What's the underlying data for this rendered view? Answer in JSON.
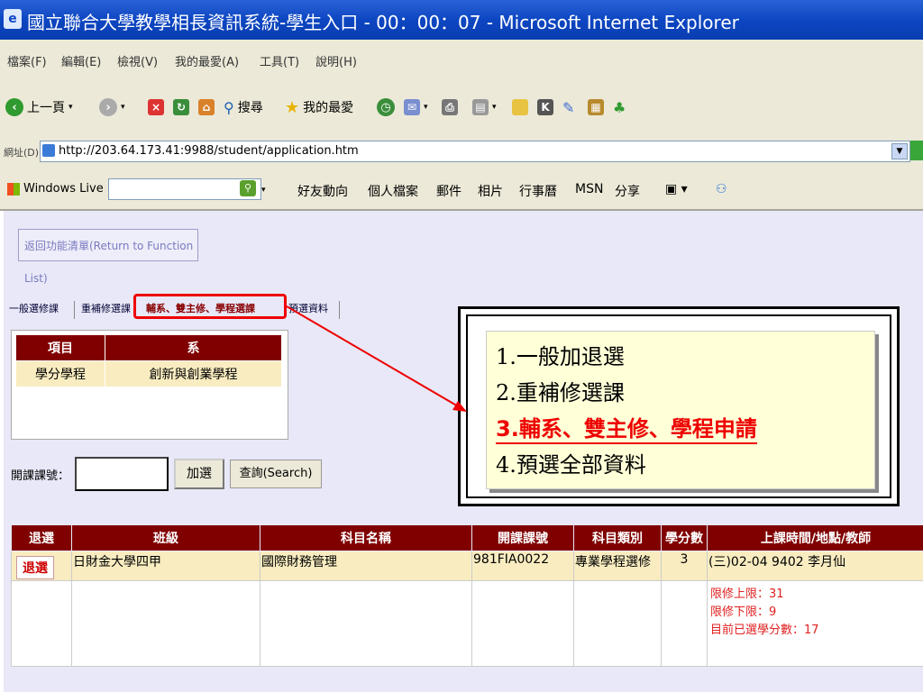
{
  "window": {
    "title": "國立聯合大學教學相長資訊系統-學生入口 - 00：00：07 - Microsoft Internet Explorer"
  },
  "menu": [
    "檔案(F)",
    "編輯(E)",
    "檢視(V)",
    "我的最愛(A)",
    "工具(T)",
    "說明(H)"
  ],
  "toolbar": {
    "back": "上一頁",
    "search": "搜尋",
    "favorites": "我的最愛"
  },
  "address": {
    "label": "網址(D)",
    "url": "http://203.64.173.41:9988/student/application.htm"
  },
  "live": {
    "brand": "Windows Live",
    "links": [
      "好友動向",
      "個人檔案",
      "郵件",
      "相片",
      "行事曆",
      "MSN",
      "分享"
    ]
  },
  "page": {
    "return_button": "返回功能清單(Return to Function List)",
    "tabs": [
      "一般選修課",
      "重補修選課",
      "輔系、雙主修、學程選課",
      "預選資料"
    ],
    "major_table": {
      "headers": [
        "項目",
        "系"
      ],
      "rows": [
        [
          "學分學程",
          "創新與創業學程"
        ]
      ]
    },
    "course_label": "開課課號：",
    "add_button": "加選",
    "search_button": "查詢(Search)",
    "enroll_table": {
      "headers": [
        "退選",
        "班級",
        "科目名稱",
        "開課課號",
        "科目類別",
        "學分數",
        "上課時間/地點/教師"
      ],
      "rows": [
        [
          "退選",
          "日財金大學四甲",
          "國際財務管理",
          "981FIA0022",
          "專業學程選修",
          "3",
          "(三)02-04 9402 李月仙"
        ]
      ],
      "limits": [
        "限修上限：31",
        "限修下限：9",
        "目前已選學分數：17"
      ]
    }
  },
  "callout": {
    "items": [
      "1.一般加退選",
      "2.重補修選課",
      "3.輔系、雙主修、學程申請",
      "4.預選全部資料"
    ]
  }
}
